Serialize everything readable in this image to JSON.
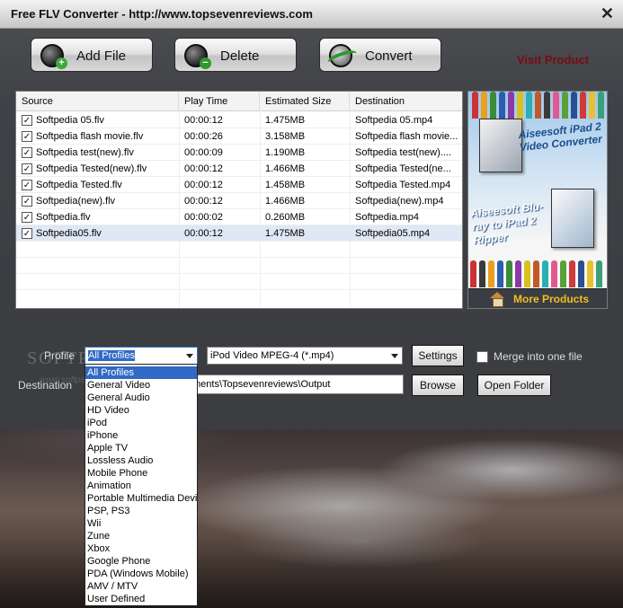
{
  "window": {
    "title": "Free FLV Converter - http://www.topsevenreviews.com",
    "close_glyph": "✕"
  },
  "toolbar": {
    "add_file": "Add File",
    "delete": "Delete",
    "convert": "Convert",
    "visit_product": "Visit Product"
  },
  "file_list": {
    "columns": [
      "Source",
      "Play Time",
      "Estimated Size",
      "Destination"
    ],
    "rows": [
      {
        "checked": true,
        "source": "Softpedia 05.flv",
        "play_time": "00:00:12",
        "size": "1.475MB",
        "destination": "Softpedia 05.mp4"
      },
      {
        "checked": true,
        "source": "Softpedia flash movie.flv",
        "play_time": "00:00:26",
        "size": "3.158MB",
        "destination": "Softpedia flash movie..."
      },
      {
        "checked": true,
        "source": "Softpedia test(new).flv",
        "play_time": "00:00:09",
        "size": "1.190MB",
        "destination": "Softpedia test(new)...."
      },
      {
        "checked": true,
        "source": "Softpedia Tested(new).flv",
        "play_time": "00:00:12",
        "size": "1.466MB",
        "destination": "Softpedia Tested(ne..."
      },
      {
        "checked": true,
        "source": "Softpedia Tested.flv",
        "play_time": "00:00:12",
        "size": "1.458MB",
        "destination": "Softpedia Tested.mp4"
      },
      {
        "checked": true,
        "source": "Softpedia(new).flv",
        "play_time": "00:00:12",
        "size": "1.466MB",
        "destination": "Softpedia(new).mp4"
      },
      {
        "checked": true,
        "source": "Softpedia.flv",
        "play_time": "00:00:02",
        "size": "0.260MB",
        "destination": "Softpedia.mp4"
      },
      {
        "checked": true,
        "source": "Softpedia05.flv",
        "play_time": "00:00:12",
        "size": "1.475MB",
        "destination": "Softpedia05.mp4"
      }
    ]
  },
  "ad": {
    "brand": "Aiseesoft",
    "product1": "Aiseesoft iPad 2 Video Converter",
    "product2": "Aiseesoft Blu-ray to iPad 2 Ripper",
    "more_products": "More Products"
  },
  "settings": {
    "profile_label": "Profile",
    "profile_value": "All Profiles",
    "format_value": "iPod Video MPEG-4 (*.mp4)",
    "settings_button": "Settings",
    "merge_label": "Merge into one file",
    "merge_checked": false,
    "destination_label": "Destination",
    "destination_value": "ments\\Topsevenreviews\\Output",
    "browse_button": "Browse",
    "open_folder_button": "Open Folder",
    "watermark": "SOFTPEDIA",
    "watermark_url": "www.softpedia.com"
  },
  "profile_dropdown": {
    "selected": "All Profiles",
    "options": [
      "All Profiles",
      "General Video",
      "General Audio",
      "HD Video",
      "iPod",
      "iPhone",
      "Apple TV",
      "Lossless Audio",
      "Mobile Phone",
      "Animation",
      "Portable Multimedia Device",
      "PSP, PS3",
      "Wii",
      "Zune",
      "Xbox",
      "Google Phone",
      "PDA (Windows Mobile)",
      "AMV / MTV",
      "User Defined"
    ]
  }
}
